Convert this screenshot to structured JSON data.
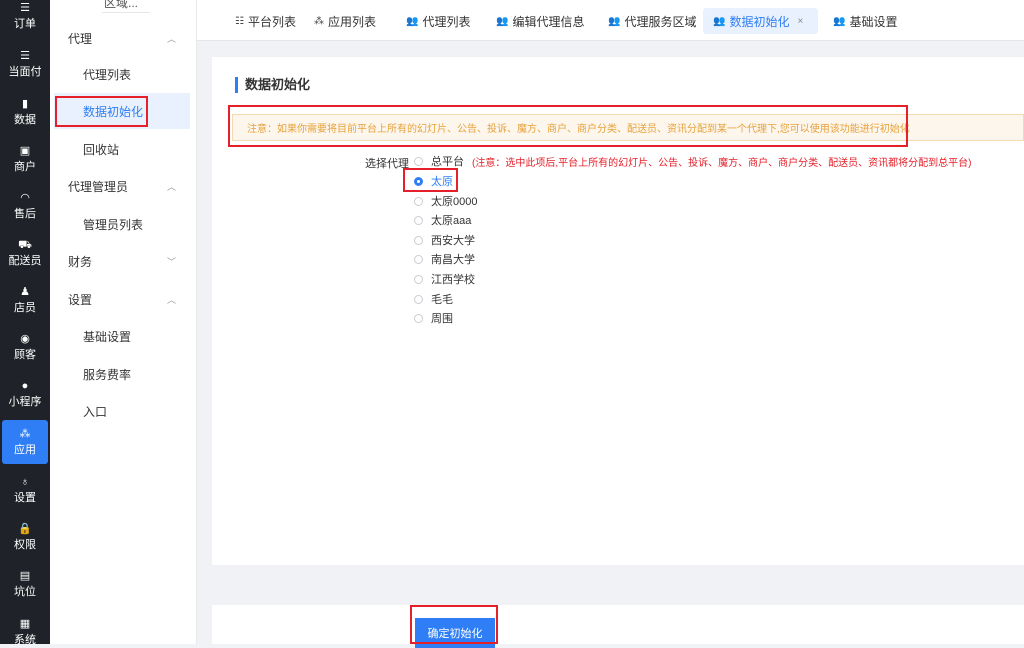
{
  "rail": {
    "items": [
      {
        "icon": "☰",
        "label": "订单"
      },
      {
        "icon": "☰",
        "label": "当面付"
      },
      {
        "icon": "▮",
        "label": "数据"
      },
      {
        "icon": "▣",
        "label": "商户"
      },
      {
        "icon": "◠",
        "label": "售后"
      },
      {
        "icon": "⛟",
        "label": "配送员"
      },
      {
        "icon": "♟",
        "label": "店员"
      },
      {
        "icon": "◉",
        "label": "顾客"
      },
      {
        "icon": "●",
        "label": "小程序"
      },
      {
        "icon": "⁂",
        "label": "应用"
      },
      {
        "icon": "♁",
        "label": "设置"
      },
      {
        "icon": "🔒",
        "label": "权限"
      },
      {
        "icon": "▤",
        "label": "坑位"
      },
      {
        "icon": "▦",
        "label": "系统"
      }
    ],
    "active_label": "应用"
  },
  "subnav": {
    "top_cut_label": "区域...",
    "groups": [
      {
        "label": "代理",
        "chevron": "︿",
        "items": [
          "代理列表",
          "数据初始化",
          "回收站"
        ]
      },
      {
        "label": "代理管理员",
        "chevron": "︿",
        "items": [
          "管理员列表"
        ]
      },
      {
        "label": "财务",
        "chevron": "﹀",
        "items": []
      },
      {
        "label": "设置",
        "chevron": "︿",
        "items": [
          "基础设置",
          "服务费率",
          "入口"
        ]
      }
    ],
    "active_item": "数据初始化"
  },
  "tabs": [
    {
      "icon": "☷",
      "label": "平台列表"
    },
    {
      "icon": "⁂",
      "label": "应用列表"
    },
    {
      "icon": "👥",
      "label": "代理列表"
    },
    {
      "icon": "👥",
      "label": "编辑代理信息"
    },
    {
      "icon": "👥",
      "label": "代理服务区域"
    },
    {
      "icon": "👥",
      "label": "数据初始化",
      "close": "×"
    },
    {
      "icon": "👥",
      "label": "基础设置"
    }
  ],
  "active_tab": "数据初始化",
  "page": {
    "title": "数据初始化",
    "notice": "注意：如果你需要将目前平台上所有的幻灯片、公告、投诉、魔方、商户、商户分类、配送员、资讯分配到某一个代理下,您可以使用该功能进行初始化",
    "select_label": "选择代理",
    "options": [
      {
        "label": "总平台",
        "note": "(注意：选中此项后,平台上所有的幻灯片、公告、投诉、魔方、商户、商户分类、配送员、资讯都将分配到总平台)"
      },
      {
        "label": "太原"
      },
      {
        "label": "太原0000"
      },
      {
        "label": "太原aaa"
      },
      {
        "label": "西安大学"
      },
      {
        "label": "南昌大学"
      },
      {
        "label": "江西学校"
      },
      {
        "label": "毛毛"
      },
      {
        "label": "周围"
      }
    ],
    "selected_option": "太原",
    "submit_label": "确定初始化"
  },
  "colors": {
    "primary": "#2f7ef5",
    "rail_bg": "#1f2329",
    "highlight_border": "#e5202a",
    "notice_text": "#e6a23c",
    "notice_bg": "#fdf6ec",
    "danger_text": "#e5202a"
  }
}
